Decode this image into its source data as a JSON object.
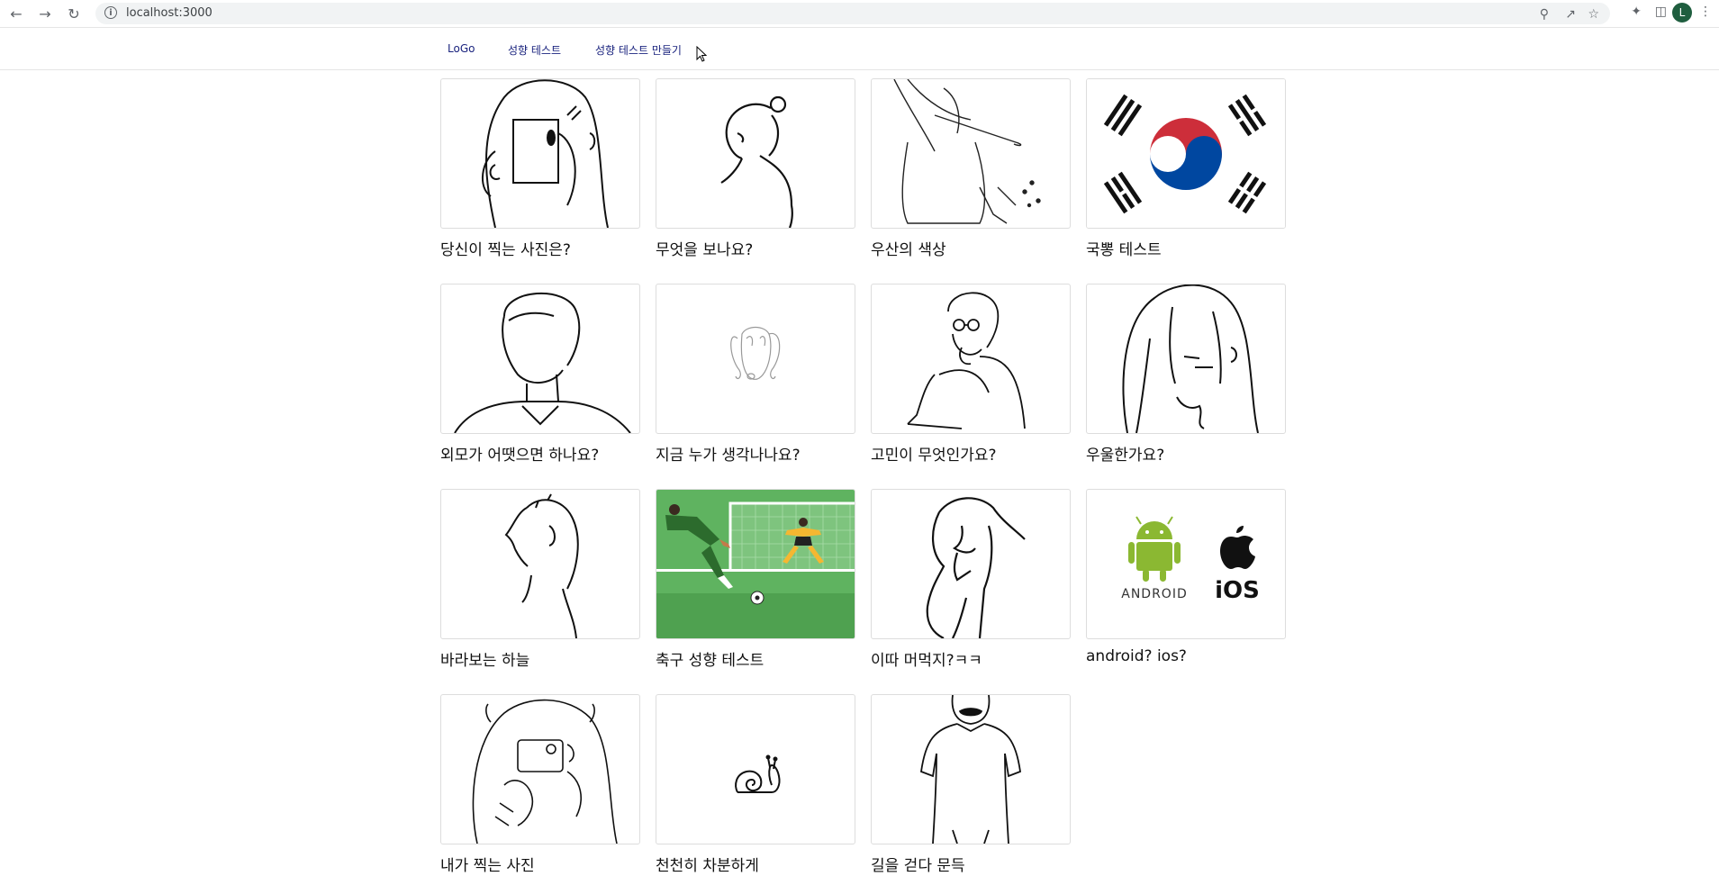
{
  "browser": {
    "url": "localhost:3000",
    "profile_initial": "L"
  },
  "navbar": {
    "logo": "LoGo",
    "tests": "성향 테스트",
    "create": "성향 테스트 만들기"
  },
  "cards": [
    {
      "title": "당신이 찍는 사진은?",
      "image": "girl-phone-illustration"
    },
    {
      "title": "무엇을 보나요?",
      "image": "girl-bun-illustration"
    },
    {
      "title": "우산의 색상",
      "image": "umbrella-person-illustration"
    },
    {
      "title": "국뽕 테스트",
      "image": "taegukgi-flag"
    },
    {
      "title": "외모가 어땟으면 하나요?",
      "image": "boy-bust-illustration"
    },
    {
      "title": "지금 누가 생각나나요?",
      "image": "rabbit-illustration"
    },
    {
      "title": "고민이 무엇인가요?",
      "image": "thinking-boy-illustration"
    },
    {
      "title": "우울한가요?",
      "image": "sad-girl-illustration"
    },
    {
      "title": "바라보는 하늘",
      "image": "looking-up-illustration"
    },
    {
      "title": "축구 성향 테스트",
      "image": "soccer-penalty-illustration"
    },
    {
      "title": "이따 머먹지?ㅋㅋ",
      "image": "girl-thinking-illustration"
    },
    {
      "title": "android? ios?",
      "image": "android-ios-logos"
    },
    {
      "title": "내가 찍는 사진",
      "image": "girl-camera-illustration"
    },
    {
      "title": "천천히 차분하게",
      "image": "snail-illustration"
    },
    {
      "title": "길을 걷다 문득",
      "image": "walking-man-illustration"
    }
  ],
  "logos": {
    "android_text": "ANDROID",
    "ios_text": "iOS",
    "android_color": "#8bb832"
  }
}
